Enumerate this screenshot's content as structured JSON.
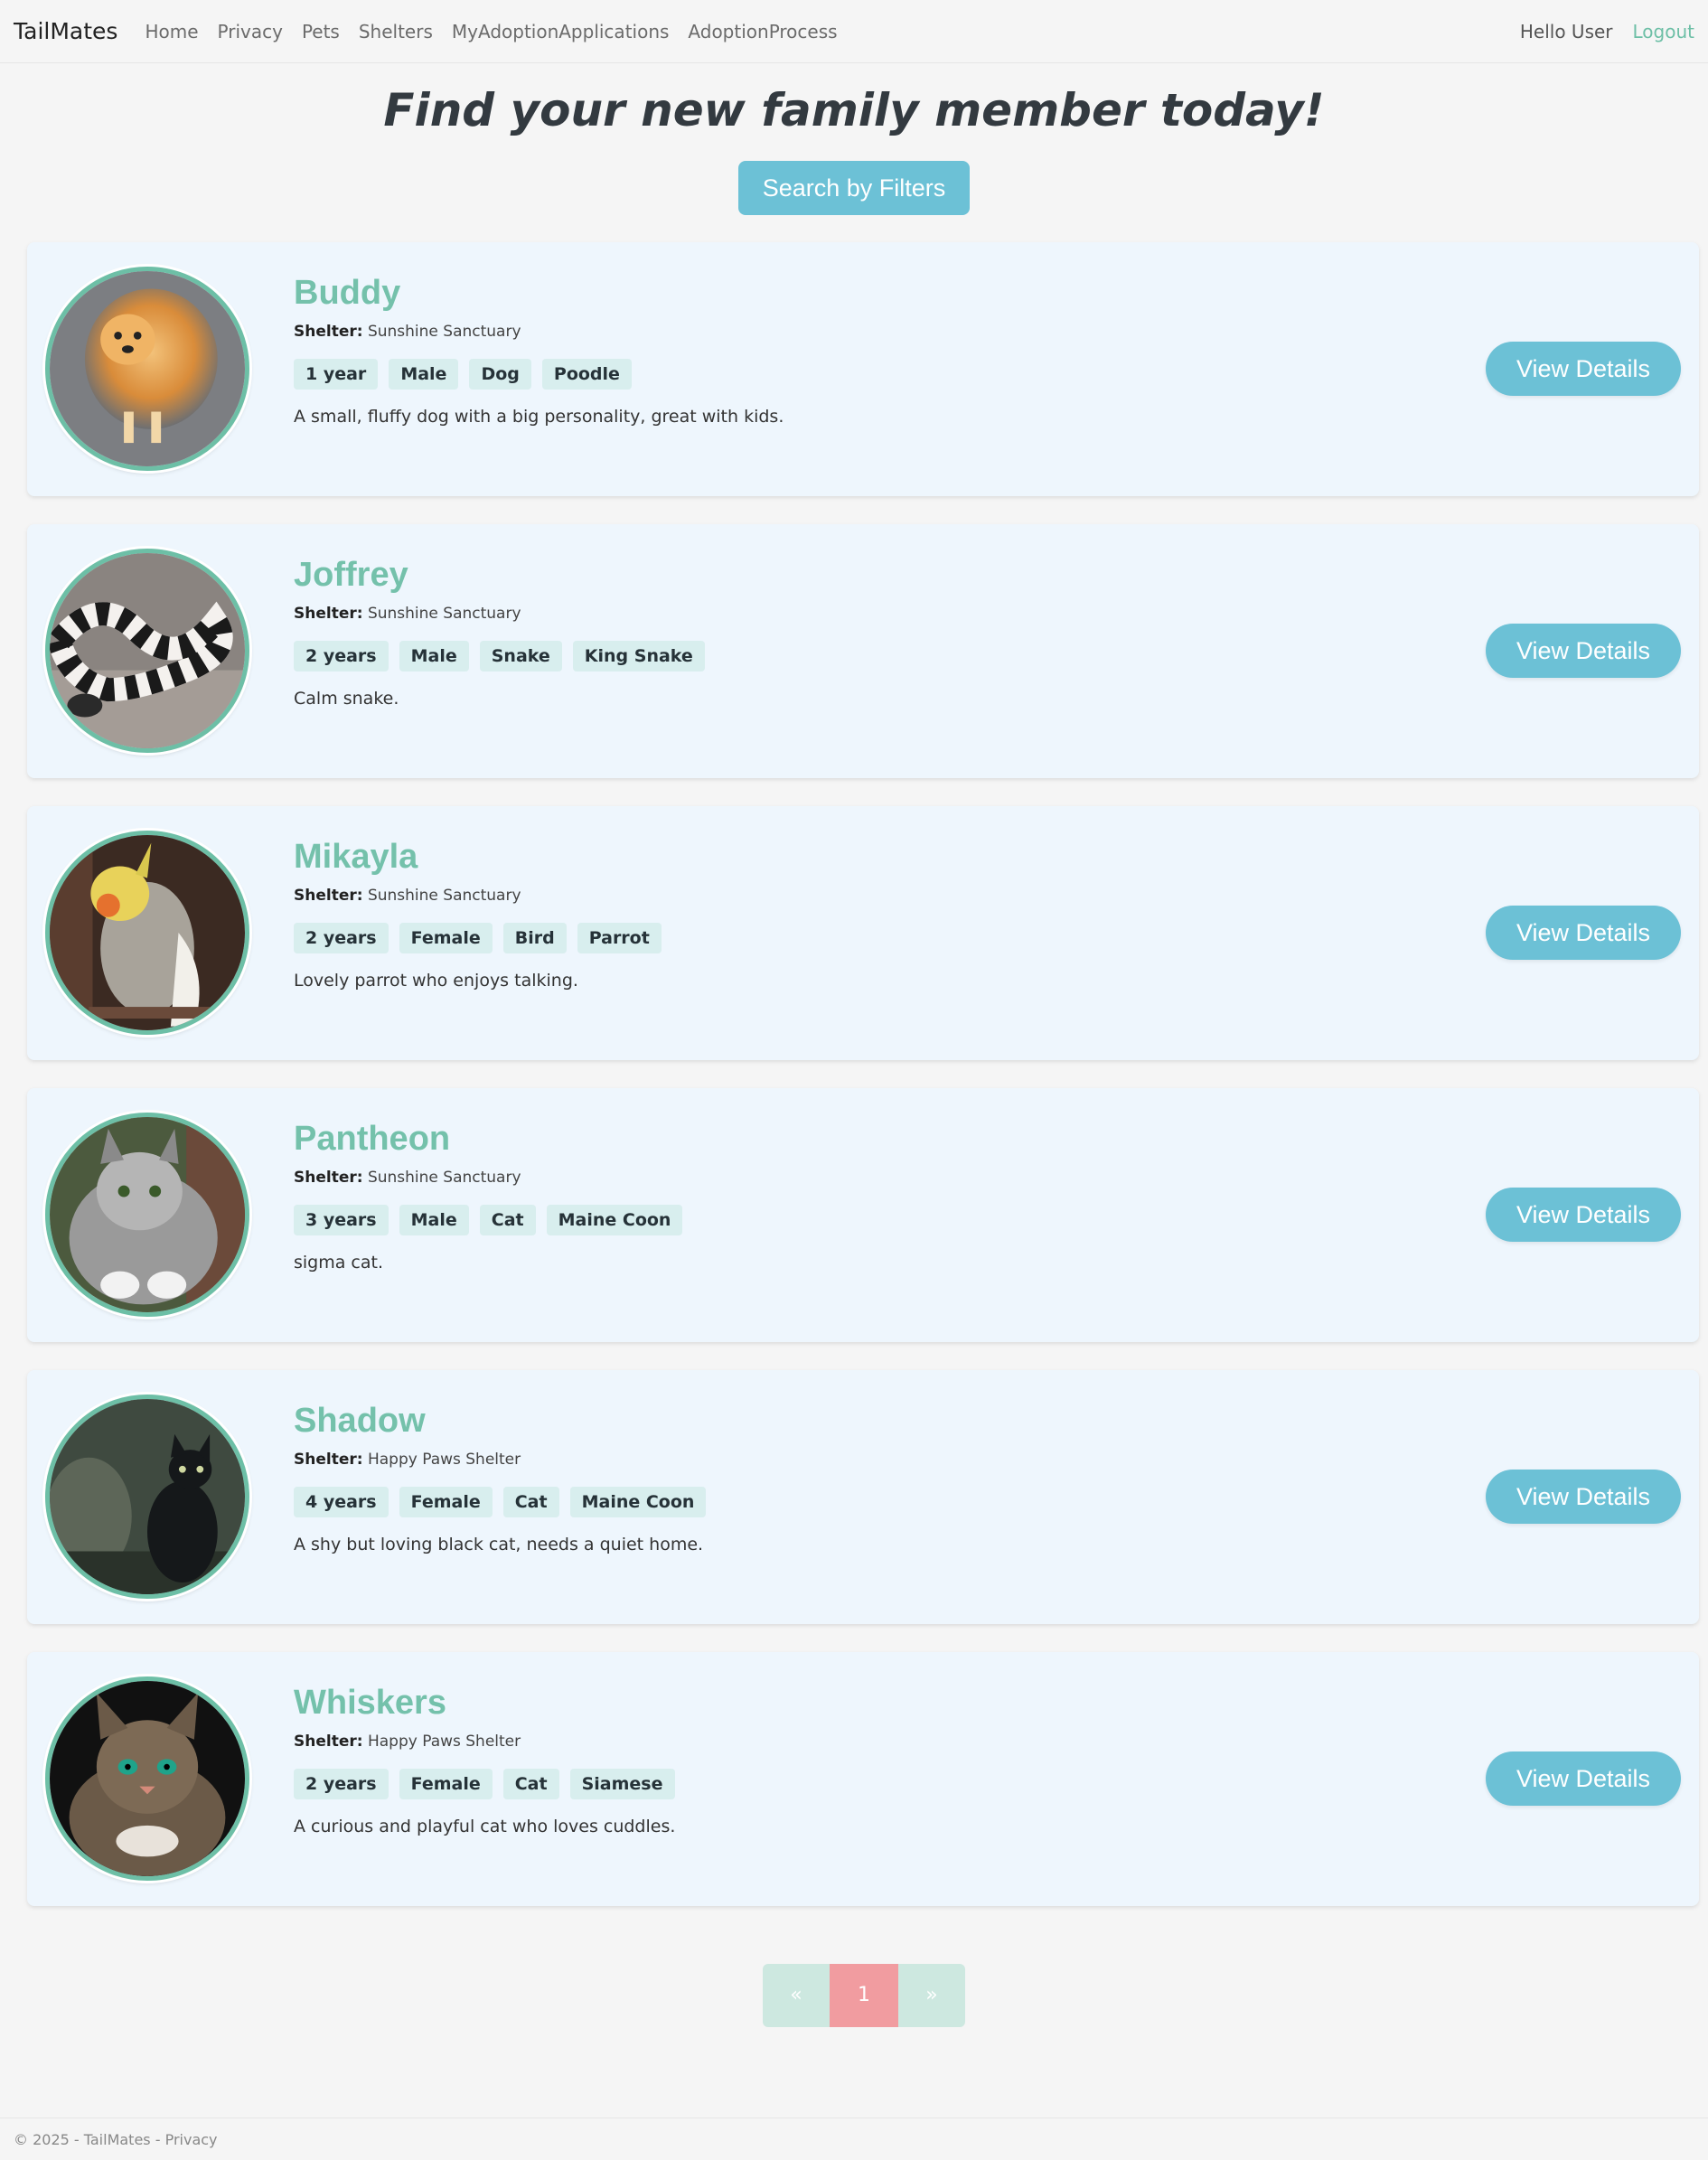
{
  "navbar": {
    "brand": "TailMates",
    "links": [
      "Home",
      "Privacy",
      "Pets",
      "Shelters",
      "MyAdoptionApplications",
      "AdoptionProcess"
    ],
    "greeting": "Hello User",
    "logout": "Logout"
  },
  "hero": {
    "title": "Find your new family member today!",
    "search_button": "Search by Filters"
  },
  "shelter_label": "Shelter:",
  "details_label": "View Details",
  "pets": [
    {
      "name": "Buddy",
      "shelter": "Sunshine Sanctuary",
      "tags": [
        "1 year",
        "Male",
        "Dog",
        "Poodle"
      ],
      "description": "A small, fluffy dog with a big personality, great with kids.",
      "photo": "pomeranian-dog-photo"
    },
    {
      "name": "Joffrey",
      "shelter": "Sunshine Sanctuary",
      "tags": [
        "2 years",
        "Male",
        "Snake",
        "King Snake"
      ],
      "description": "Calm snake.",
      "photo": "king-snake-photo"
    },
    {
      "name": "Mikayla",
      "shelter": "Sunshine Sanctuary",
      "tags": [
        "2 years",
        "Female",
        "Bird",
        "Parrot"
      ],
      "description": "Lovely parrot who enjoys talking.",
      "photo": "cockatiel-photo"
    },
    {
      "name": "Pantheon",
      "shelter": "Sunshine Sanctuary",
      "tags": [
        "3 years",
        "Male",
        "Cat",
        "Maine Coon"
      ],
      "description": "sigma cat.",
      "photo": "maine-coon-photo"
    },
    {
      "name": "Shadow",
      "shelter": "Happy Paws Shelter",
      "tags": [
        "4 years",
        "Female",
        "Cat",
        "Maine Coon"
      ],
      "description": "A shy but loving black cat, needs a quiet home.",
      "photo": "black-cat-photo"
    },
    {
      "name": "Whiskers",
      "shelter": "Happy Paws Shelter",
      "tags": [
        "2 years",
        "Female",
        "Cat",
        "Siamese"
      ],
      "description": "A curious and playful cat who loves cuddles.",
      "photo": "tabby-cat-photo"
    }
  ],
  "pagination": {
    "prev": "«",
    "current": "1",
    "next": "»"
  },
  "footer": {
    "text": "© 2025 - TailMates - Privacy"
  },
  "colors": {
    "accent": "#6cc1d6",
    "name_green": "#74c1ab",
    "card_bg": "#eef6fd",
    "page_active": "#f19ca0"
  }
}
